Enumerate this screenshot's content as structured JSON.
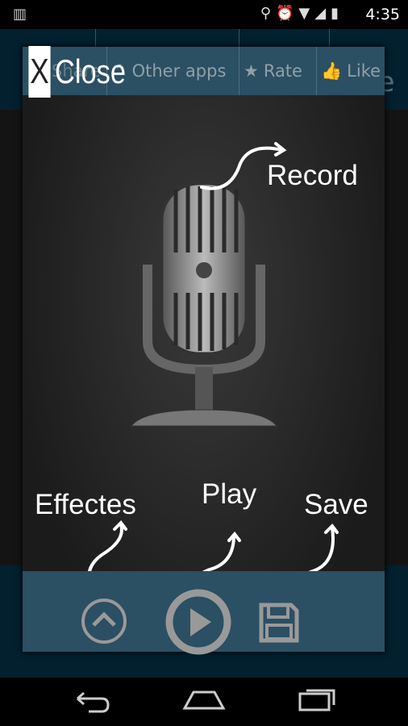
{
  "status_bar": {
    "time": "4:35"
  },
  "app_toolbar": {
    "share": "Share",
    "other_apps": "Other apps",
    "rate": "Rate",
    "like": "Like"
  },
  "overlay": {
    "close_label": "Close",
    "close_x": "X",
    "hints": {
      "record": "Record",
      "effects": "Effectes",
      "play": "Play",
      "save": "Save"
    }
  },
  "colors": {
    "panel": "#2b4f63",
    "icon": "#9a9a9a",
    "app_bar": "#03202f"
  }
}
